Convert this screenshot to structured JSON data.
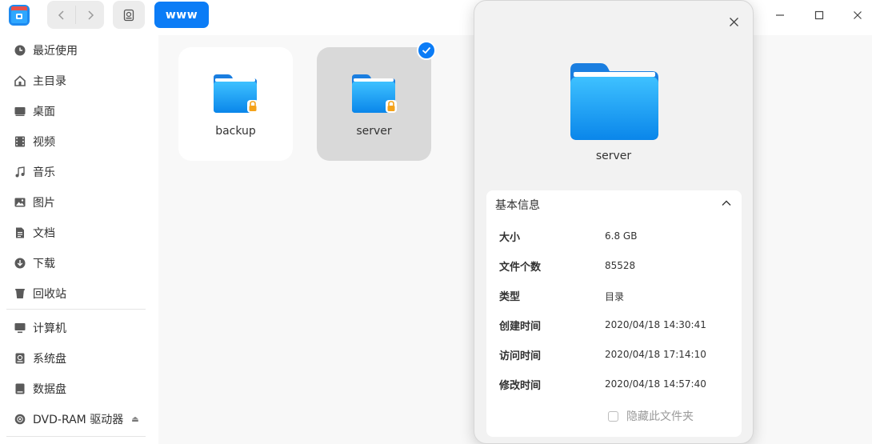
{
  "titlebar": {
    "breadcrumb": "www",
    "icons": [
      "file-manager-logo",
      "back-arrow",
      "forward-arrow",
      "view-mode",
      "minimize",
      "maximize",
      "close"
    ]
  },
  "sidebar": {
    "items": [
      {
        "label": "最近使用",
        "icon": "clock-icon"
      },
      {
        "label": "主目录",
        "icon": "home-icon"
      },
      {
        "label": "桌面",
        "icon": "desktop-icon"
      },
      {
        "label": "视频",
        "icon": "video-icon"
      },
      {
        "label": "音乐",
        "icon": "music-icon"
      },
      {
        "label": "图片",
        "icon": "picture-icon"
      },
      {
        "label": "文档",
        "icon": "document-icon"
      },
      {
        "label": "下载",
        "icon": "download-icon"
      },
      {
        "label": "回收站",
        "icon": "trash-icon"
      }
    ],
    "devices": [
      {
        "label": "计算机",
        "icon": "computer-icon"
      },
      {
        "label": "系统盘",
        "icon": "disk-icon"
      },
      {
        "label": "数据盘",
        "icon": "disk-icon"
      },
      {
        "label": "DVD-RAM 驱动器",
        "icon": "optical-drive-icon",
        "eject": "⏏"
      }
    ]
  },
  "files": [
    {
      "name": "backup",
      "locked": true,
      "selected": false
    },
    {
      "name": "server",
      "locked": true,
      "selected": true
    }
  ],
  "properties": {
    "name": "server",
    "section_title": "基本信息",
    "rows": [
      {
        "key": "大小",
        "value": "6.8 GB"
      },
      {
        "key": "文件个数",
        "value": "85528"
      },
      {
        "key": "类型",
        "value": "目录"
      },
      {
        "key": "创建时间",
        "value": "2020/04/18 14:30:41"
      },
      {
        "key": "访问时间",
        "value": "2020/04/18 17:14:10"
      },
      {
        "key": "修改时间",
        "value": "2020/04/18 14:57:40"
      }
    ],
    "hide_folder_label": "隐藏此文件夹",
    "hide_folder_checked": false
  },
  "colors": {
    "accent": "#0b7cf6",
    "folder_top": "#3ec1ff",
    "folder_bottom": "#0a86ea",
    "lock": "#f4a21a"
  }
}
